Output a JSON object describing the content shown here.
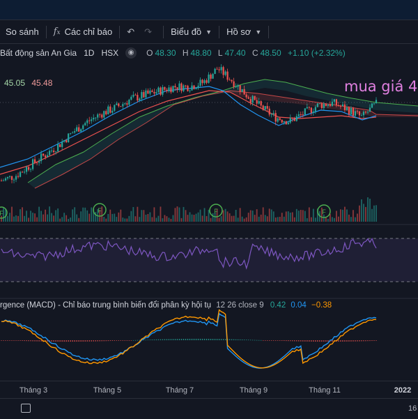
{
  "toolbar": {
    "compare_label": "So sánh",
    "indicators_label": "Các chỉ báo",
    "chart_type_label": "Biểu đồ",
    "profile_label": "Hồ sơ"
  },
  "legend": {
    "symbol_name": "Bất động sản An Gia",
    "interval": "1D",
    "exchange": "HSX",
    "open_label": "O",
    "open": "48.30",
    "high_label": "H",
    "high": "48.80",
    "low_label": "L",
    "low": "47.40",
    "close_label": "C",
    "close": "48.50",
    "change": "+1.10 (+2.32%)"
  },
  "ichimoku": {
    "value1": "45.05",
    "value2": "45.48"
  },
  "annotation": "mua giá 4",
  "macd": {
    "title": "rgence (MACD) - Chỉ báo trung bình biến đổi phân kỳ hội tụ",
    "params": "12 26 close 9",
    "macd_value": "0.42",
    "signal_value": "0.04",
    "hist_value": "−0.38"
  },
  "xaxis": {
    "labels": [
      "Tháng 3",
      "Tháng 5",
      "Tháng 7",
      "Tháng 9",
      "Tháng 11",
      "2022"
    ]
  },
  "bottom": {
    "right_label": "16"
  },
  "colors": {
    "up": "#26a69a",
    "down": "#ef5350",
    "rsi": "#7e57c2",
    "macd_line": "#2196f3",
    "signal_line": "#ff9800",
    "annotation": "#e080e0"
  },
  "icons": [
    "compare-icon",
    "fx-indicators-icon",
    "undo-icon",
    "redo-icon",
    "chevron-down-icon",
    "eye-icon",
    "calendar-icon",
    "earnings-icon"
  ],
  "chart_data": {
    "type": "candlestick",
    "x": [
      "Tháng 3",
      "Tháng 5",
      "Tháng 7",
      "Tháng 9",
      "Tháng 11",
      "2022"
    ],
    "close_points": [
      41.0,
      41.5,
      42.5,
      43.5,
      44.5,
      45.8,
      46.8,
      47.6,
      48.2,
      49.0,
      49.4,
      49.8,
      50.2,
      50.2,
      50.6,
      52.0,
      50.8,
      49.4,
      48.2,
      47.2,
      46.8,
      47.6,
      48.4,
      48.6,
      48.0,
      47.2,
      48.5
    ],
    "last": {
      "open": 48.3,
      "high": 48.8,
      "low": 47.4,
      "close": 48.5
    }
  }
}
